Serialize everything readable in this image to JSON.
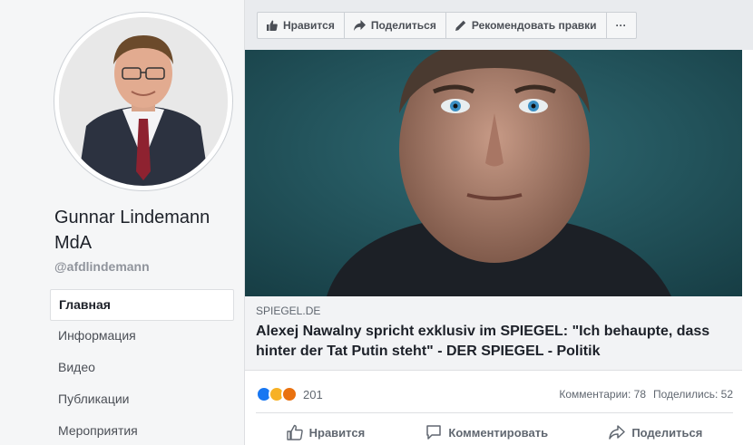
{
  "profile": {
    "name": "Gunnar Lindemann MdA",
    "handle": "@afdlindemann"
  },
  "nav": {
    "items": [
      {
        "label": "Главная",
        "active": true
      },
      {
        "label": "Информация",
        "active": false
      },
      {
        "label": "Видео",
        "active": false
      },
      {
        "label": "Публикации",
        "active": false
      },
      {
        "label": "Мероприятия",
        "active": false
      }
    ]
  },
  "toolbar": {
    "like_label": "Нравится",
    "share_label": "Поделиться",
    "suggest_edits_label": "Рекомендовать правки",
    "more_label": "···"
  },
  "post": {
    "link": {
      "domain": "SPIEGEL.DE",
      "headline": "Alexej Nawalny spricht exklusiv im SPIEGEL: \"Ich behaupte, dass hinter der Tat Putin steht\" - DER SPIEGEL - Politik"
    },
    "stats": {
      "reactions_count": "201",
      "comments": "Комментарии: 78",
      "shares": "Поделились: 52"
    },
    "actions": {
      "like": "Нравится",
      "comment": "Комментировать",
      "share": "Поделиться"
    }
  },
  "colors": {
    "facebook_blue": "#4267b2",
    "reaction_like": "#1877f2",
    "reaction_haha": "#f7b125",
    "reaction_angry": "#e9710f"
  }
}
